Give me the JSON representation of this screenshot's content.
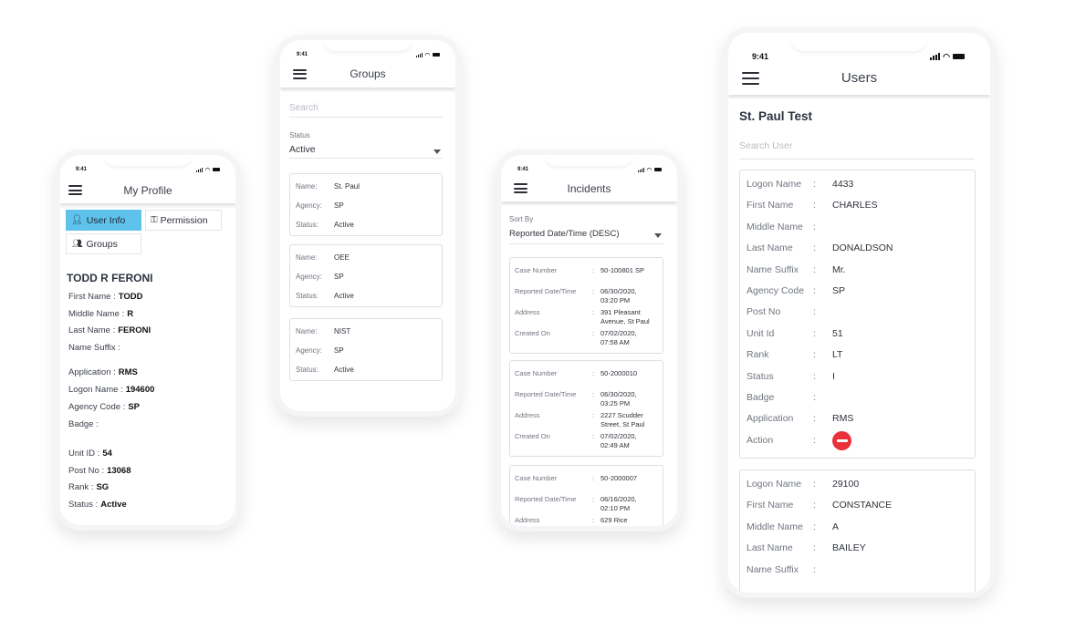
{
  "status_time": "9:41",
  "profile": {
    "title": "My Profile",
    "tabs": {
      "user_info": "User Info",
      "permission": "Permission",
      "groups": "Groups"
    },
    "name": "TODD R FERONI",
    "fields": [
      {
        "label": "First Name :",
        "value": "TODD"
      },
      {
        "label": "Middle Name :",
        "value": "R"
      },
      {
        "label": "Last Name :",
        "value": "FERONI"
      },
      {
        "label": "Name Suffix :",
        "value": ""
      },
      {
        "label": "Application :",
        "value": "RMS"
      },
      {
        "label": "Logon Name :",
        "value": "194600"
      },
      {
        "label": "Agency Code :",
        "value": "SP"
      },
      {
        "label": "Badge :",
        "value": ""
      },
      {
        "label": "Unit ID :",
        "value": "54"
      },
      {
        "label": "Post No :",
        "value": "13068"
      },
      {
        "label": "Rank :",
        "value": "SG"
      },
      {
        "label": "Status :",
        "value": "Active"
      }
    ]
  },
  "groups": {
    "title": "Groups",
    "search_placeholder": "Search",
    "status_label": "Status",
    "status_value": "Active",
    "labels": {
      "name": "Name:",
      "agency": "Agency:",
      "status": "Status:"
    },
    "items": [
      {
        "name": "St. Paul",
        "agency": "SP",
        "status": "Active"
      },
      {
        "name": "OEE",
        "agency": "SP",
        "status": "Active"
      },
      {
        "name": "NIST",
        "agency": "SP",
        "status": "Active"
      }
    ]
  },
  "incidents": {
    "title": "Incidents",
    "sort_label": "Sort By",
    "sort_value": "Reported Date/Time (DESC)",
    "labels": {
      "case": "Case Number",
      "reported": "Reported Date/Time",
      "address": "Address",
      "created": "Created On"
    },
    "items": [
      {
        "case": "50-100801 SP",
        "reported_1": "06/30/2020,",
        "reported_2": "03:20 PM",
        "address_1": "391 Pleasant",
        "address_2": "Avenue, St Paul",
        "created_1": "07/02/2020,",
        "created_2": "07:58 AM"
      },
      {
        "case": "50-2000010",
        "reported_1": "06/30/2020,",
        "reported_2": "03:25 PM",
        "address_1": "2227 Scudder",
        "address_2": "Street, St Paul",
        "created_1": "07/02/2020,",
        "created_2": "02:49 AM"
      },
      {
        "case": "50-2000007",
        "reported_1": "06/16/2020,",
        "reported_2": "02:10 PM",
        "address_1": "629 Rice",
        "address_2": "",
        "created_1": "",
        "created_2": ""
      }
    ]
  },
  "users": {
    "title": "Users",
    "org": "St. Paul Test",
    "search_placeholder": "Search User",
    "user1": [
      {
        "label": "Logon Name",
        "sep": ":",
        "value": "4433"
      },
      {
        "label": "First Name",
        "sep": ":",
        "value": "CHARLES"
      },
      {
        "label": "Middle Name",
        "sep": ":",
        "value": ""
      },
      {
        "label": "Last Name",
        "sep": ":",
        "value": "DONALDSON"
      },
      {
        "label": "Name Suffix",
        "sep": ":",
        "value": "Mr."
      },
      {
        "label": "Agency Code",
        "sep": ":",
        "value": "SP"
      },
      {
        "label": "Post No",
        "sep": ":",
        "value": ""
      },
      {
        "label": "Unit Id",
        "sep": ":",
        "value": "51"
      },
      {
        "label": "Rank",
        "sep": ":",
        "value": "LT"
      },
      {
        "label": "Status",
        "sep": ":",
        "value": "I"
      },
      {
        "label": "Badge",
        "sep": ":",
        "value": ""
      },
      {
        "label": "Application",
        "sep": ":",
        "value": "RMS"
      },
      {
        "label": "Action",
        "sep": ":",
        "value": ""
      }
    ],
    "user2": [
      {
        "label": "Logon Name",
        "sep": ":",
        "value": "29100"
      },
      {
        "label": "First Name",
        "sep": ":",
        "value": "CONSTANCE"
      },
      {
        "label": "Middle Name",
        "sep": ":",
        "value": "A"
      },
      {
        "label": "Last Name",
        "sep": ":",
        "value": "BAILEY"
      },
      {
        "label": "Name Suffix",
        "sep": ":",
        "value": ""
      }
    ]
  },
  "colors": {
    "accent_tab": "#5ec2ec",
    "action_red": "#e8313a"
  }
}
